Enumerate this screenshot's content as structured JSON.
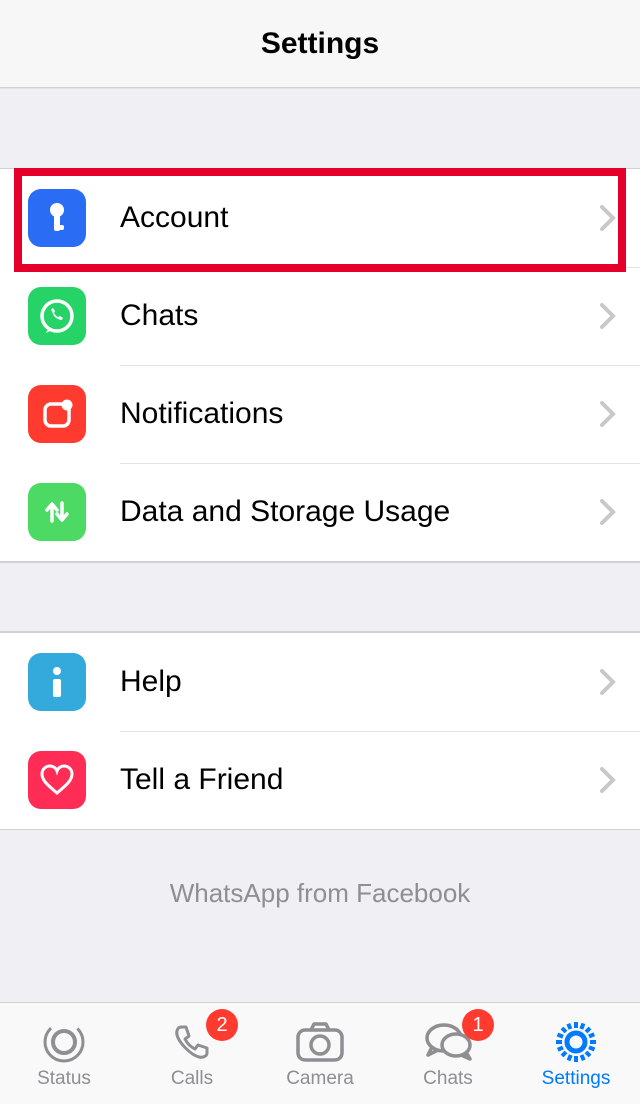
{
  "header": {
    "title": "Settings"
  },
  "groups": {
    "main": [
      {
        "label": "Account",
        "icon": "key",
        "bg": "#2a6df4"
      },
      {
        "label": "Chats",
        "icon": "whatsapp",
        "bg": "#25d366"
      },
      {
        "label": "Notifications",
        "icon": "notification",
        "bg": "#ff3b30"
      },
      {
        "label": "Data and Storage Usage",
        "icon": "updown",
        "bg": "#4cd964"
      }
    ],
    "secondary": [
      {
        "label": "Help",
        "icon": "info",
        "bg": "#34aadc"
      },
      {
        "label": "Tell a Friend",
        "icon": "heart",
        "bg": "#ff2d55"
      }
    ]
  },
  "footer": {
    "text": "WhatsApp from Facebook"
  },
  "tabs": [
    {
      "label": "Status",
      "icon": "status",
      "badge": null,
      "active": false
    },
    {
      "label": "Calls",
      "icon": "calls",
      "badge": "2",
      "active": false
    },
    {
      "label": "Camera",
      "icon": "camera",
      "badge": null,
      "active": false
    },
    {
      "label": "Chats",
      "icon": "chats",
      "badge": "1",
      "active": false
    },
    {
      "label": "Settings",
      "icon": "settings",
      "badge": null,
      "active": true
    }
  ],
  "highlight": {
    "target": "account-row"
  },
  "colors": {
    "accent": "#007aff",
    "badge": "#ff3b30"
  }
}
